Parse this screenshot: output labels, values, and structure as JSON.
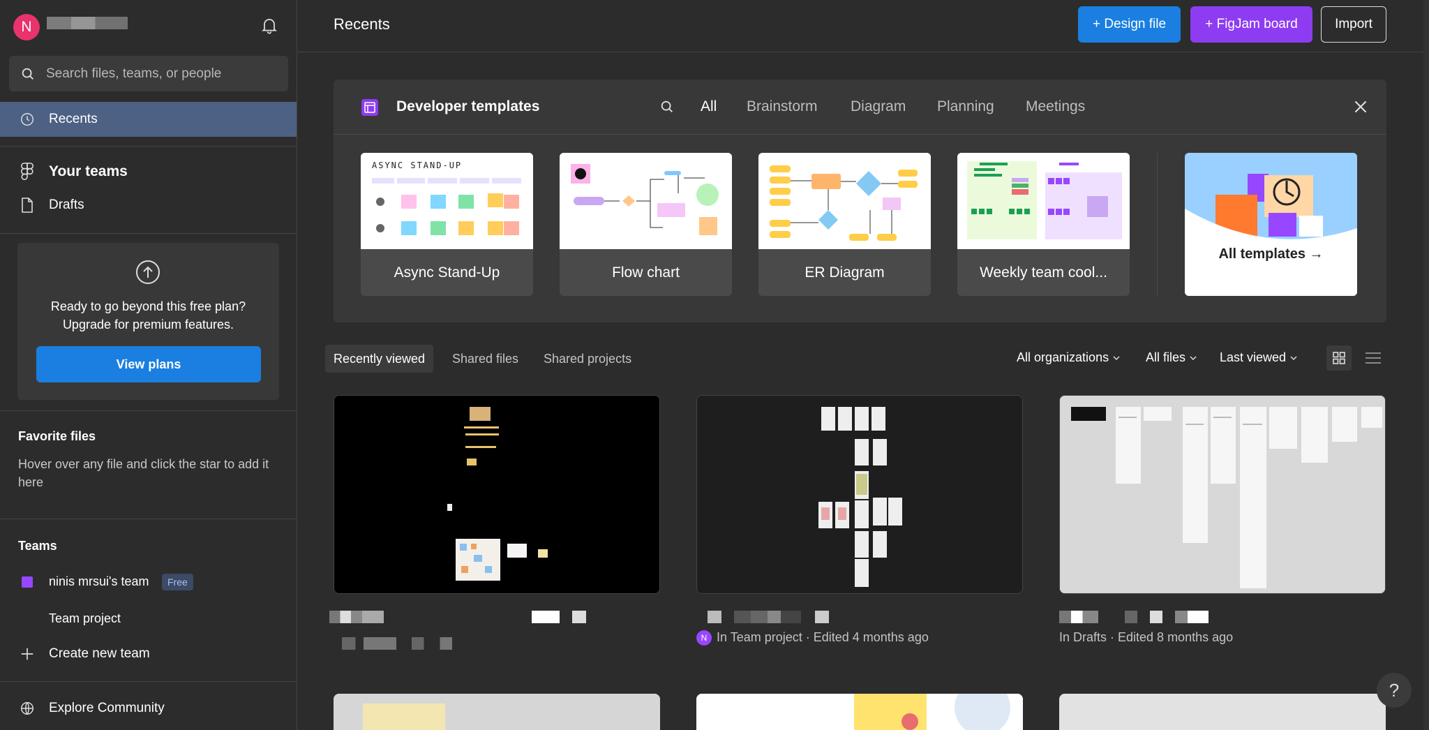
{
  "user": {
    "avatar_initial": "N"
  },
  "search": {
    "placeholder": "Search files, teams, or people"
  },
  "nav": {
    "recents": "Recents",
    "your_teams": "Your teams",
    "drafts": "Drafts",
    "explore": "Explore Community"
  },
  "upgrade": {
    "line1": "Ready to go beyond this free plan?",
    "line2": "Upgrade for premium features.",
    "button": "View plans"
  },
  "favorites": {
    "title": "Favorite files",
    "text": "Hover over any file and click the star to add it here"
  },
  "teams": {
    "title": "Teams",
    "team_name": "ninis mrsui's team",
    "team_badge": "Free",
    "project": "Team project",
    "create": "Create new team"
  },
  "header": {
    "title": "Recents",
    "design_file": "+ Design file",
    "figjam_board": "+ FigJam board",
    "import": "Import"
  },
  "templates": {
    "title": "Developer templates",
    "tabs": [
      "All",
      "Brainstorm",
      "Diagram",
      "Planning",
      "Meetings"
    ],
    "cards": [
      "Async Stand-Up",
      "Flow chart",
      "ER Diagram",
      "Weekly team cool..."
    ],
    "all_templates": "All templates →",
    "async_heading": "ASYNC STAND-UP"
  },
  "filters": {
    "tabs": [
      "Recently viewed",
      "Shared files",
      "Shared projects"
    ],
    "organizations": "All organizations",
    "files": "All files",
    "sort": "Last viewed"
  },
  "files": [
    {
      "meta": ""
    },
    {
      "meta": "In Team project · Edited 4 months ago",
      "owner_initial": "N"
    },
    {
      "meta": "In Drafts · Edited 8 months ago"
    }
  ],
  "help": "?",
  "colors": {
    "accent_blue": "#1a7fe0",
    "figjam_purple": "#8e3cf1",
    "active_nav": "#4d6185",
    "avatar": "#e8336d"
  }
}
